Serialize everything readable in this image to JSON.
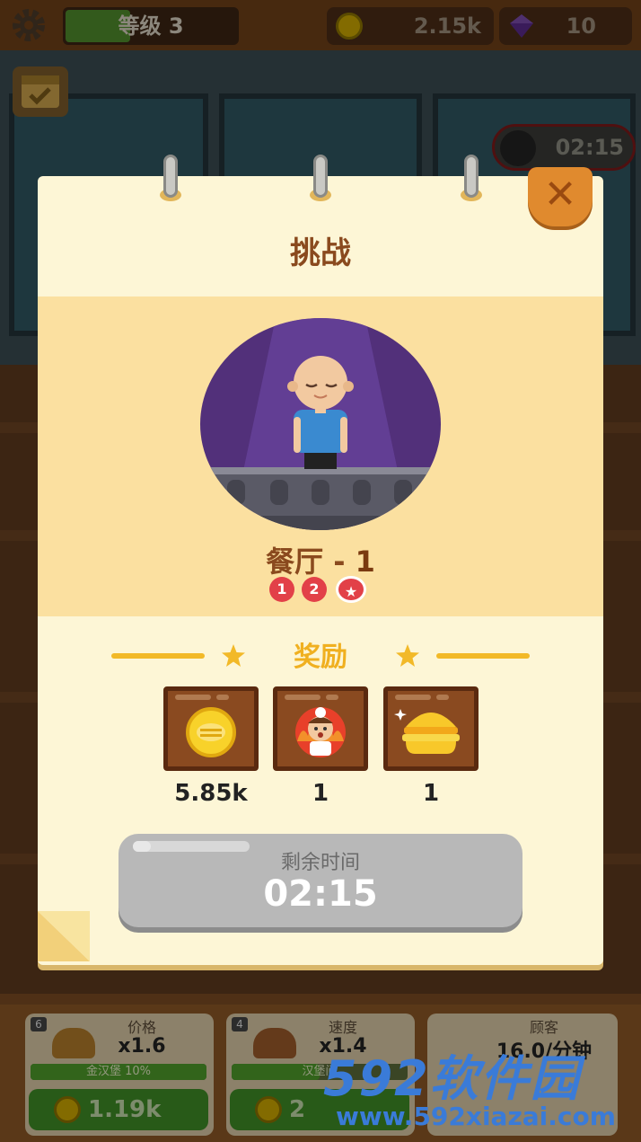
{
  "hud": {
    "level_label": "等级 3",
    "level_progress": 0.38,
    "coins": "2.15k",
    "gems": "10",
    "challenge_timer": "02:15"
  },
  "modal": {
    "title": "挑战",
    "stage_name": "餐厅 - ",
    "stage_number": "1",
    "stage_steps": [
      "1",
      "2",
      "★"
    ],
    "rewards_title": "奖励",
    "rewards": [
      {
        "icon": "coin-icon",
        "value": "5.85k"
      },
      {
        "icon": "chef-icon",
        "value": "1"
      },
      {
        "icon": "burger-icon",
        "value": "1"
      }
    ],
    "timer_label": "剩余时间",
    "timer_value": "02:15",
    "close_symbol": "✕"
  },
  "bottom_cards": [
    {
      "num": "6",
      "label": "价格",
      "mult": "x1.6",
      "bar_text": "金汉堡 10%",
      "bar_progress": 1.0,
      "price": "1.19k"
    },
    {
      "num": "4",
      "label": "速度",
      "mult": "x1.4",
      "bar_text": "汉堡间",
      "bar_progress": 0.5,
      "price": "2"
    },
    {
      "num": "",
      "label": "顾客",
      "mult": "16.0/分钟",
      "bar_text": "",
      "bar_progress": 0,
      "price": ""
    }
  ],
  "watermark": {
    "brand": "592软件园",
    "url": "www.592xiazai.com"
  },
  "colors": {
    "accent": "#f0b020",
    "title_brown": "#8a4a1e",
    "close_orange": "#e08a2e",
    "badge_red": "#e24048"
  }
}
